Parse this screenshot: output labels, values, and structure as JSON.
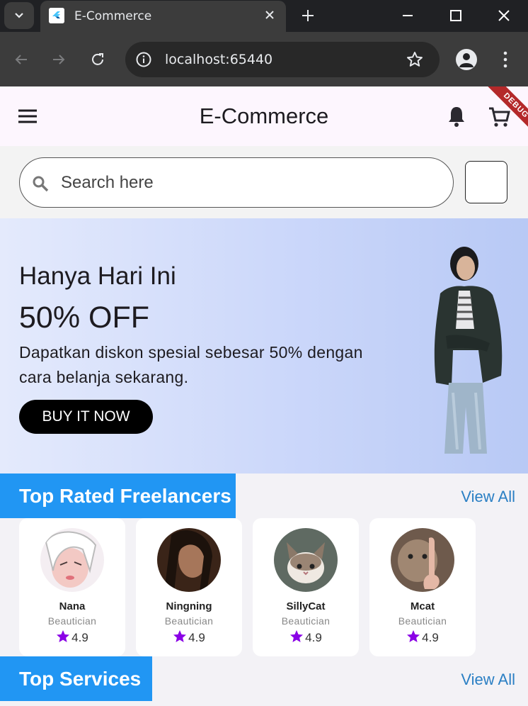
{
  "browser": {
    "tab_title": "E-Commerce",
    "url": "localhost:65440"
  },
  "app": {
    "title": "E-Commerce",
    "debug_label": "DEBUG"
  },
  "search": {
    "placeholder": "Search here"
  },
  "banner": {
    "title": "Hanya Hari Ini",
    "discount": "50% OFF",
    "description": "Dapatkan diskon spesial sebesar 50% dengan cara belanja sekarang.",
    "button_label": "BUY IT NOW"
  },
  "top_freelancers": {
    "heading": "Top Rated Freelancers",
    "view_all": "View All",
    "items": [
      {
        "name": "Nana",
        "role": "Beautician",
        "rating": "4.9"
      },
      {
        "name": "Ningning",
        "role": "Beautician",
        "rating": "4.9"
      },
      {
        "name": "SillyCat",
        "role": "Beautician",
        "rating": "4.9"
      },
      {
        "name": "Mcat",
        "role": "Beautician",
        "rating": "4.9"
      }
    ]
  },
  "top_services": {
    "heading": "Top Services",
    "view_all": "View All"
  },
  "colors": {
    "accent": "#2196f3",
    "star": "#8a00e6",
    "view_all": "#2a7fc4"
  }
}
